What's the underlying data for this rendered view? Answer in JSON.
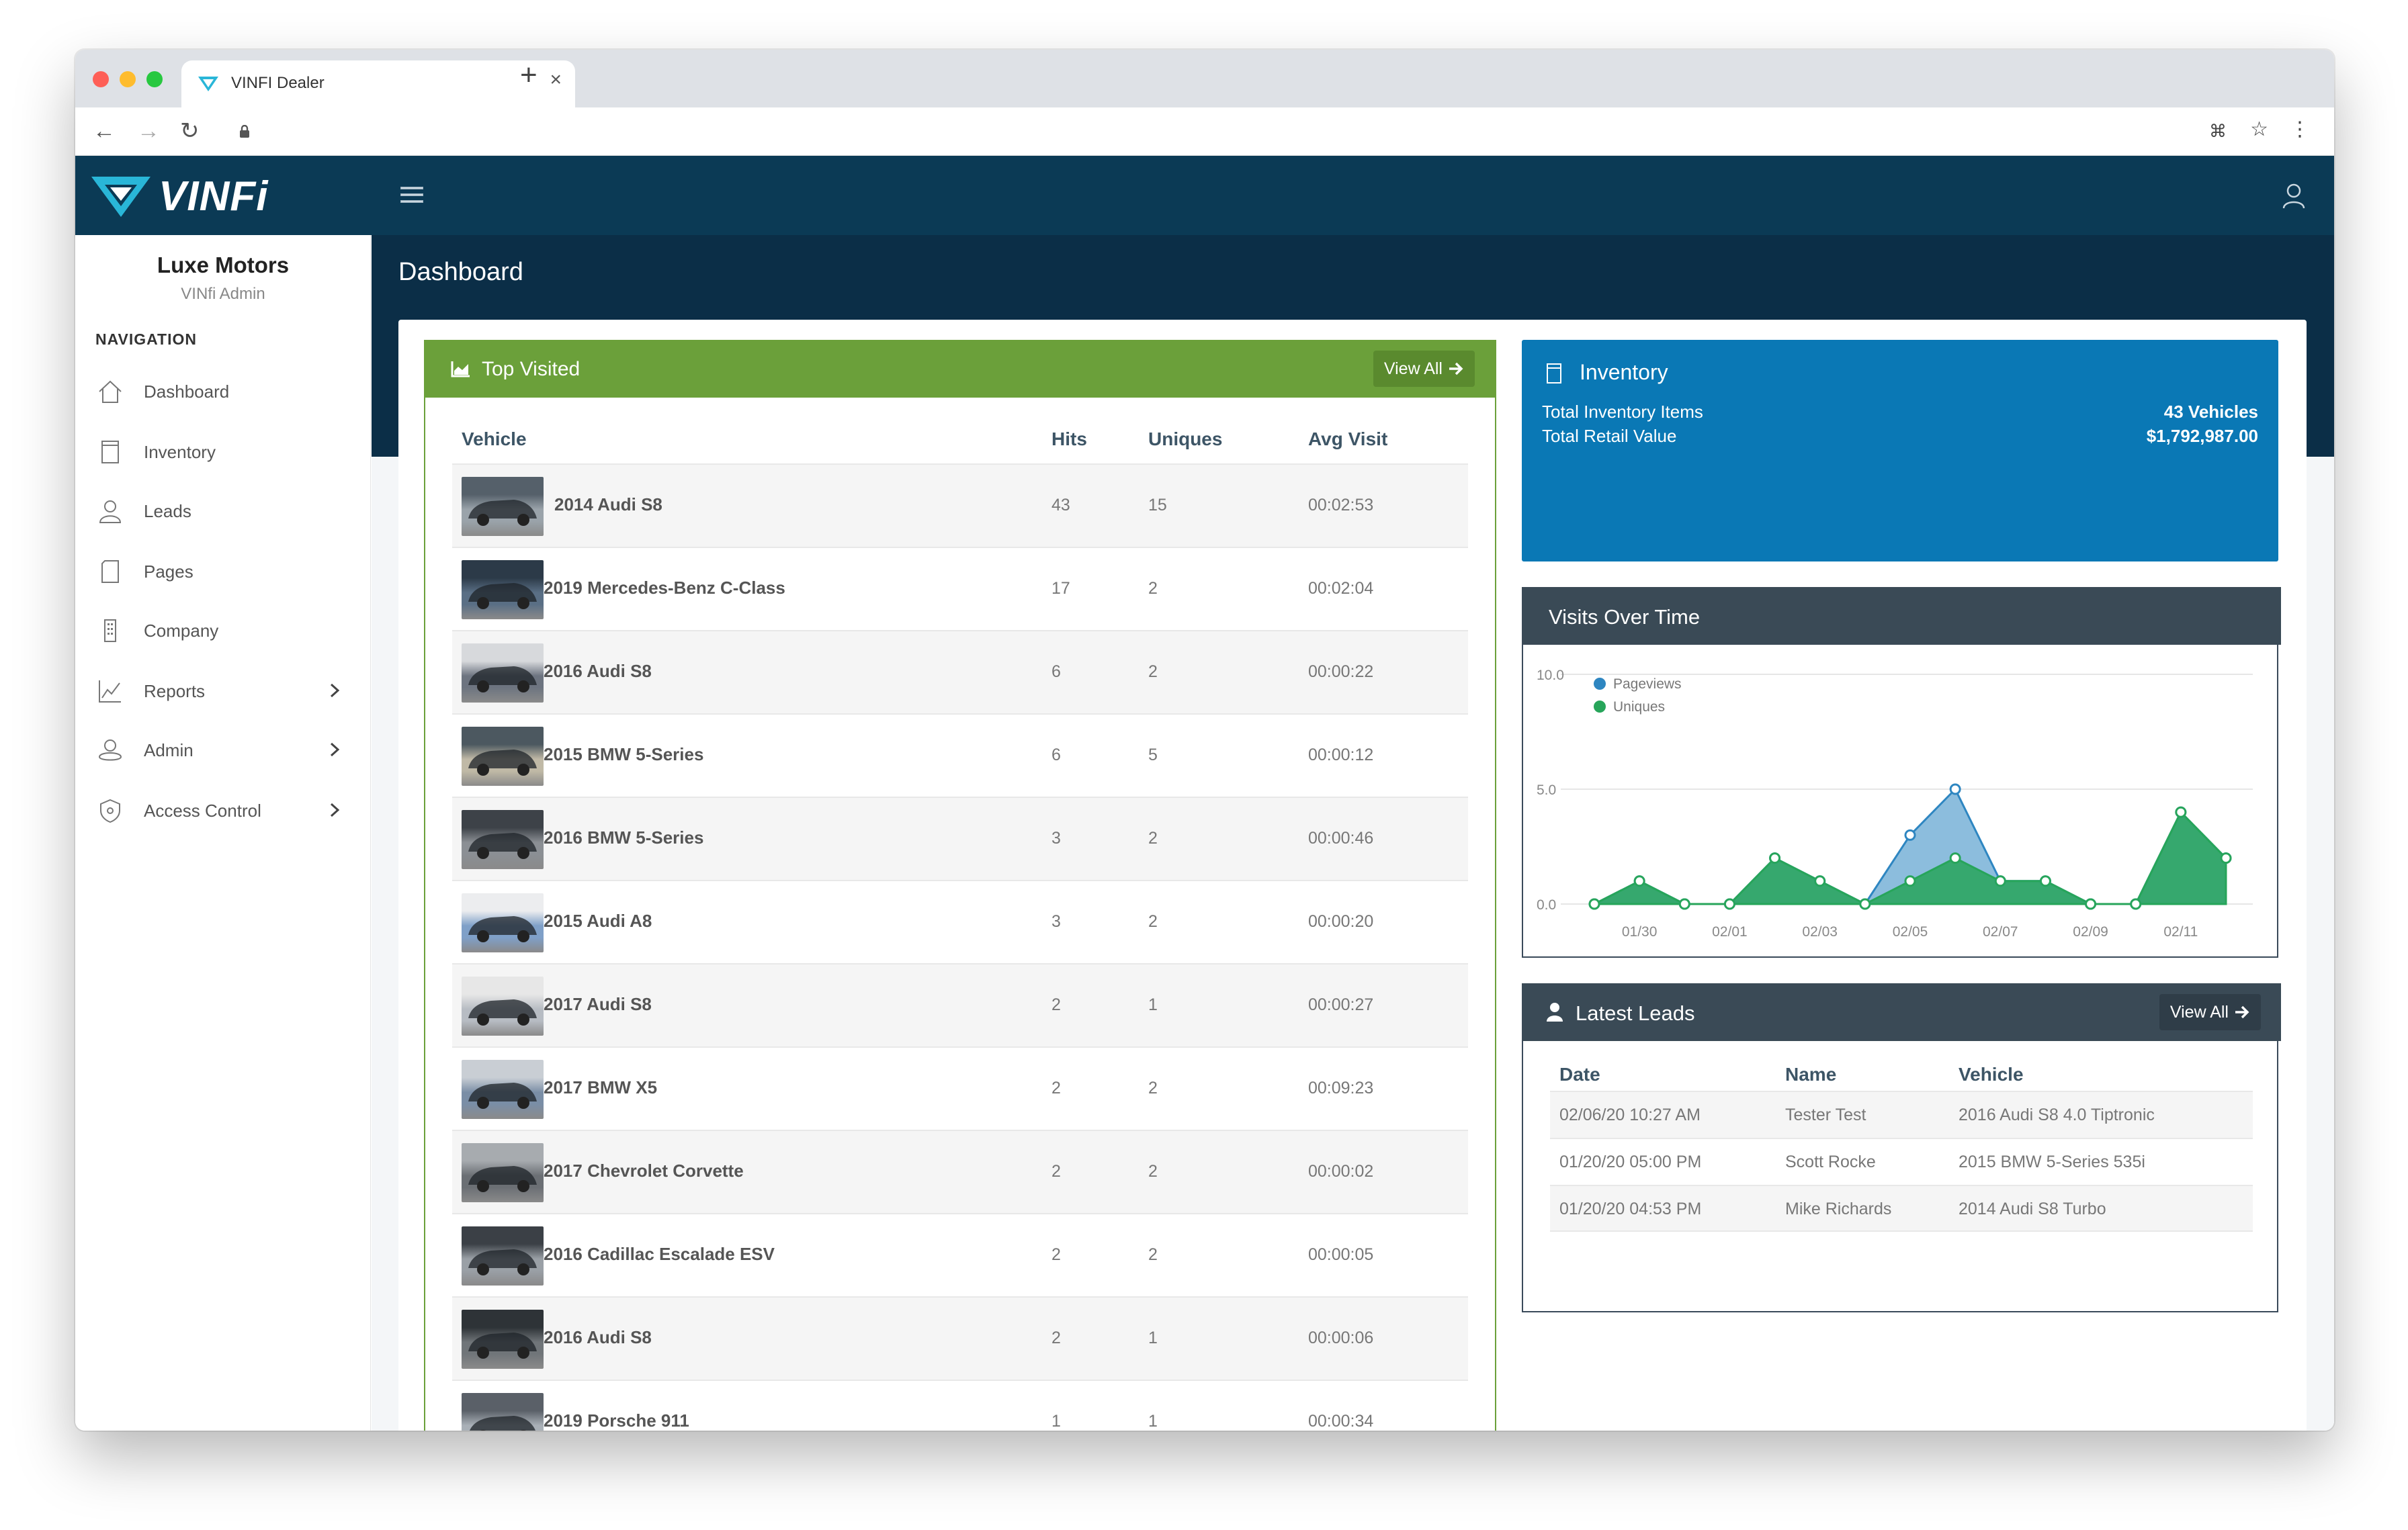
{
  "browser": {
    "tab_title": "VINFI Dealer",
    "close_glyph": "×",
    "new_tab_glyph": "+",
    "back_glyph": "←",
    "forward_glyph": "→",
    "reload_glyph": "↻",
    "translate_glyph": "⌘",
    "star_glyph": "☆",
    "menu_glyph": "⋮"
  },
  "app": {
    "logo_text": "VINFi",
    "brand_color": "#0b3a55",
    "accent_color": "#29b6d8"
  },
  "sidebar": {
    "company_name": "Luxe Motors",
    "company_role": "VINfi Admin",
    "nav_heading": "NAVIGATION",
    "items": [
      {
        "label": "Dashboard",
        "icon": "home-icon",
        "has_submenu": false
      },
      {
        "label": "Inventory",
        "icon": "document-icon",
        "has_submenu": false
      },
      {
        "label": "Leads",
        "icon": "user-icon",
        "has_submenu": false
      },
      {
        "label": "Pages",
        "icon": "page-icon",
        "has_submenu": false
      },
      {
        "label": "Company",
        "icon": "building-icon",
        "has_submenu": false
      },
      {
        "label": "Reports",
        "icon": "chart-icon",
        "has_submenu": true
      },
      {
        "label": "Admin",
        "icon": "admin-icon",
        "has_submenu": true
      },
      {
        "label": "Access Control",
        "icon": "shield-icon",
        "has_submenu": true
      }
    ]
  },
  "main": {
    "page_title": "Dashboard"
  },
  "top_visited": {
    "title": "Top Visited",
    "view_all": "View All",
    "header_color": "#6ba03a",
    "columns": [
      "Vehicle",
      "Hits",
      "Uniques",
      "Avg Visit"
    ],
    "rows": [
      {
        "vehicle": "2014 Audi S8",
        "hits": "43",
        "uniques": "15",
        "avg": "00:02:53"
      },
      {
        "vehicle": "2019 Mercedes-Benz C-Class",
        "hits": "17",
        "uniques": "2",
        "avg": "00:02:04"
      },
      {
        "vehicle": "2016 Audi S8",
        "hits": "6",
        "uniques": "2",
        "avg": "00:00:22"
      },
      {
        "vehicle": "2015 BMW 5-Series",
        "hits": "6",
        "uniques": "5",
        "avg": "00:00:12"
      },
      {
        "vehicle": "2016 BMW 5-Series",
        "hits": "3",
        "uniques": "2",
        "avg": "00:00:46"
      },
      {
        "vehicle": "2015 Audi A8",
        "hits": "3",
        "uniques": "2",
        "avg": "00:00:20"
      },
      {
        "vehicle": "2017 Audi S8",
        "hits": "2",
        "uniques": "1",
        "avg": "00:00:27"
      },
      {
        "vehicle": "2017 BMW X5",
        "hits": "2",
        "uniques": "2",
        "avg": "00:09:23"
      },
      {
        "vehicle": "2017 Chevrolet Corvette",
        "hits": "2",
        "uniques": "2",
        "avg": "00:00:02"
      },
      {
        "vehicle": "2016 Cadillac Escalade ESV",
        "hits": "2",
        "uniques": "2",
        "avg": "00:00:05"
      },
      {
        "vehicle": "2016 Audi S8",
        "hits": "2",
        "uniques": "1",
        "avg": "00:00:06"
      },
      {
        "vehicle": "2019 Porsche 911",
        "hits": "1",
        "uniques": "1",
        "avg": "00:00:34"
      }
    ]
  },
  "inventory": {
    "title": "Inventory",
    "color": "#0a78b5",
    "rows": [
      {
        "label": "Total Inventory Items",
        "value": "43 Vehicles"
      },
      {
        "label": "Total Retail Value",
        "value": "$1,792,987.00"
      }
    ]
  },
  "visits": {
    "title": "Visits Over Time"
  },
  "chart_data": {
    "type": "area",
    "title": "Visits Over Time",
    "x": [
      "01/29",
      "01/30",
      "01/31",
      "02/01",
      "02/02",
      "02/03",
      "02/04",
      "02/05",
      "02/06",
      "02/07",
      "02/08",
      "02/09",
      "02/10",
      "02/11",
      "02/12"
    ],
    "x_tick_labels": [
      "01/30",
      "02/01",
      "02/03",
      "02/05",
      "02/07",
      "02/09",
      "02/11"
    ],
    "y_ticks": [
      "10.0",
      "5.0",
      "0.0"
    ],
    "ylim": [
      0,
      10
    ],
    "grid": true,
    "legend_position": "top-left",
    "series": [
      {
        "name": "Pageviews",
        "color": "#2e86c1",
        "values": [
          0,
          1,
          0,
          0,
          2,
          1,
          0,
          3,
          5,
          1,
          1,
          0,
          0,
          4,
          2
        ]
      },
      {
        "name": "Uniques",
        "color": "#27a55a",
        "values": [
          0,
          1,
          0,
          0,
          2,
          1,
          0,
          1,
          2,
          1,
          1,
          0,
          0,
          4,
          2
        ]
      }
    ]
  },
  "latest_leads": {
    "title": "Latest Leads",
    "view_all": "View All",
    "columns": [
      "Date",
      "Name",
      "Vehicle"
    ],
    "rows": [
      {
        "date": "02/06/20 10:27 AM",
        "name": "Tester Test",
        "vehicle": "2016 Audi S8 4.0 Tiptronic"
      },
      {
        "date": "01/20/20 05:00 PM",
        "name": "Scott Rocke",
        "vehicle": "2015 BMW 5-Series 535i"
      },
      {
        "date": "01/20/20 04:53 PM",
        "name": "Mike Richards",
        "vehicle": "2014 Audi S8 Turbo"
      }
    ]
  }
}
